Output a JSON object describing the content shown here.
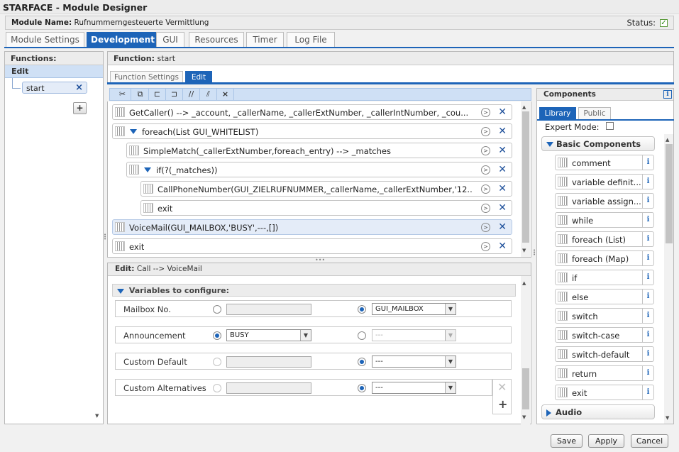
{
  "window": {
    "title": "STARFACE - Module Designer"
  },
  "module": {
    "name_label": "Module Name:",
    "name": "Rufnummerngesteuerte Vermittlung",
    "status_label": "Status:"
  },
  "main_tabs": [
    {
      "label": "Module Settings"
    },
    {
      "label": "Development"
    },
    {
      "label": "GUI"
    },
    {
      "label": "Resources"
    },
    {
      "label": "Timer"
    },
    {
      "label": "Log File"
    }
  ],
  "functions": {
    "title": "Functions:",
    "edit_label": "Edit",
    "items": [
      {
        "label": "start"
      }
    ]
  },
  "function_panel": {
    "title_label": "Function:",
    "title_name": "start",
    "tabs": [
      {
        "label": "Function Settings"
      },
      {
        "label": "Edit"
      }
    ],
    "rows": [
      {
        "text": "GetCaller() --> _account, _callerName, _callerExtNumber, _callerIntNumber, _cou..."
      },
      {
        "text": "foreach(List GUI_WHITELIST)"
      },
      {
        "text": "SimpleMatch(_callerExtNumber,foreach_entry) --> _matches"
      },
      {
        "text": "if(?(_matches))"
      },
      {
        "text": "CallPhoneNumber(GUI_ZIELRUFNUMMER,_callerName,_callerExtNumber,'12..."
      },
      {
        "text": "exit"
      },
      {
        "text": "VoiceMail(GUI_MAILBOX,'BUSY',---,[])"
      },
      {
        "text": "exit"
      }
    ]
  },
  "edit_panel": {
    "title_label": "Edit:",
    "title_name": "Call --> VoiceMail",
    "section_title": "Variables to configure:",
    "rows": [
      {
        "label": "Mailbox No.",
        "combo": "GUI_MAILBOX",
        "left_combo": ""
      },
      {
        "label": "Announcement",
        "combo": "---",
        "left_combo": "BUSY"
      },
      {
        "label": "Custom Default",
        "combo": "---",
        "left_combo": ""
      },
      {
        "label": "Custom Alternatives",
        "combo": "---",
        "left_combo": ""
      }
    ]
  },
  "components": {
    "title": "Components",
    "tabs": [
      {
        "label": "Library"
      },
      {
        "label": "Public"
      }
    ],
    "expert_mode_label": "Expert Mode:",
    "group_basic": "Basic Components",
    "items": [
      {
        "label": "comment"
      },
      {
        "label": "variable definit..."
      },
      {
        "label": "variable assign..."
      },
      {
        "label": "while"
      },
      {
        "label": "foreach (List)"
      },
      {
        "label": "foreach (Map)"
      },
      {
        "label": "if"
      },
      {
        "label": "else"
      },
      {
        "label": "switch"
      },
      {
        "label": "switch-case"
      },
      {
        "label": "switch-default"
      },
      {
        "label": "return"
      },
      {
        "label": "exit"
      }
    ],
    "group_audio": "Audio"
  },
  "buttons": {
    "save": "Save",
    "apply": "Apply",
    "cancel": "Cancel"
  },
  "colors": {
    "accent": "#1d64b8",
    "selection": "#cfe0f5",
    "status_ok": "#2f8a16"
  }
}
